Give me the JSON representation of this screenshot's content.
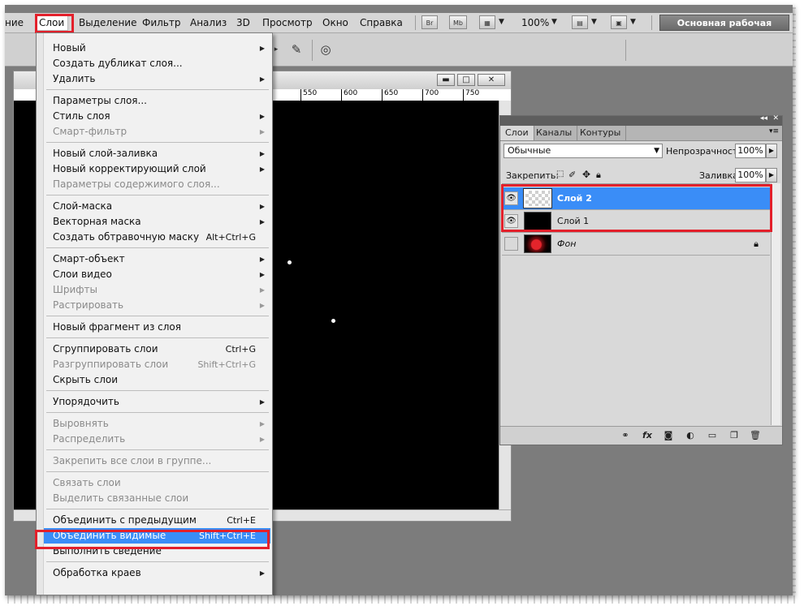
{
  "menubar": {
    "items": [
      "ние",
      "Слои",
      "Выделение",
      "Фильтр",
      "Анализ",
      "3D",
      "Просмотр",
      "Окно",
      "Справка"
    ],
    "active": "Слои",
    "br_label": "Br",
    "mb_label": "Mb",
    "zoom": "100%",
    "workspace": "Основная рабочая среда"
  },
  "ruler": {
    "ticks": [
      "550",
      "600",
      "650",
      "700",
      "750"
    ]
  },
  "layers_panel": {
    "tabs": [
      "Слои",
      "Каналы",
      "Контуры"
    ],
    "blend_mode": "Обычные",
    "opacity_label": "Непрозрачность:",
    "opacity": "100%",
    "lock_label": "Закрепить:",
    "fill_label": "Заливка:",
    "fill": "100%",
    "layers": [
      {
        "name": "Слой 2",
        "selected": true,
        "visible": true,
        "thumb": "transparent"
      },
      {
        "name": "Слой 1",
        "selected": false,
        "visible": true,
        "thumb": "black"
      },
      {
        "name": "Фон",
        "selected": false,
        "visible": false,
        "thumb": "rose-photo",
        "locked": true
      }
    ],
    "bottom_icons": [
      "link-icon",
      "fx-icon",
      "mask-icon",
      "adjustment-icon",
      "group-icon",
      "new-layer-icon",
      "trash-icon"
    ]
  },
  "layer_menu": {
    "groups": [
      [
        {
          "label": "Новый",
          "submenu": true
        },
        {
          "label": "Создать дубликат слоя..."
        },
        {
          "label": "Удалить",
          "submenu": true
        }
      ],
      [
        {
          "label": "Параметры слоя..."
        },
        {
          "label": "Стиль слоя",
          "submenu": true
        },
        {
          "label": "Смарт-фильтр",
          "submenu": true,
          "disabled": true
        }
      ],
      [
        {
          "label": "Новый слой-заливка",
          "submenu": true
        },
        {
          "label": "Новый корректирующий слой",
          "submenu": true
        },
        {
          "label": "Параметры содержимого слоя...",
          "disabled": true
        }
      ],
      [
        {
          "label": "Слой-маска",
          "submenu": true
        },
        {
          "label": "Векторная маска",
          "submenu": true
        },
        {
          "label": "Создать обтравочную маску",
          "shortcut": "Alt+Ctrl+G"
        }
      ],
      [
        {
          "label": "Смарт-объект",
          "submenu": true
        },
        {
          "label": "Слои видео",
          "submenu": true
        },
        {
          "label": "Шрифты",
          "submenu": true,
          "disabled": true
        },
        {
          "label": "Растрировать",
          "submenu": true,
          "disabled": true
        }
      ],
      [
        {
          "label": "Новый фрагмент из слоя"
        }
      ],
      [
        {
          "label": "Сгруппировать слои",
          "shortcut": "Ctrl+G"
        },
        {
          "label": "Разгруппировать слои",
          "shortcut": "Shift+Ctrl+G",
          "disabled": true
        },
        {
          "label": "Скрыть слои"
        }
      ],
      [
        {
          "label": "Упорядочить",
          "submenu": true
        }
      ],
      [
        {
          "label": "Выровнять",
          "submenu": true,
          "disabled": true
        },
        {
          "label": "Распределить",
          "submenu": true,
          "disabled": true
        }
      ],
      [
        {
          "label": "Закрепить все слои в группе...",
          "disabled": true
        }
      ],
      [
        {
          "label": "Связать слои",
          "disabled": true
        },
        {
          "label": "Выделить связанные слои",
          "disabled": true
        }
      ],
      [
        {
          "label": "Объединить с предыдущим",
          "shortcut": "Ctrl+E"
        },
        {
          "label": "Объединить видимые",
          "shortcut": "Shift+Ctrl+E",
          "highlighted": true
        },
        {
          "label": "Выполнить сведение"
        }
      ],
      [
        {
          "label": "Обработка краев",
          "submenu": true
        }
      ]
    ]
  },
  "colors": {
    "highlight": "#3a8df7",
    "annotation_red": "#e3202b",
    "canvas": "#000000"
  }
}
